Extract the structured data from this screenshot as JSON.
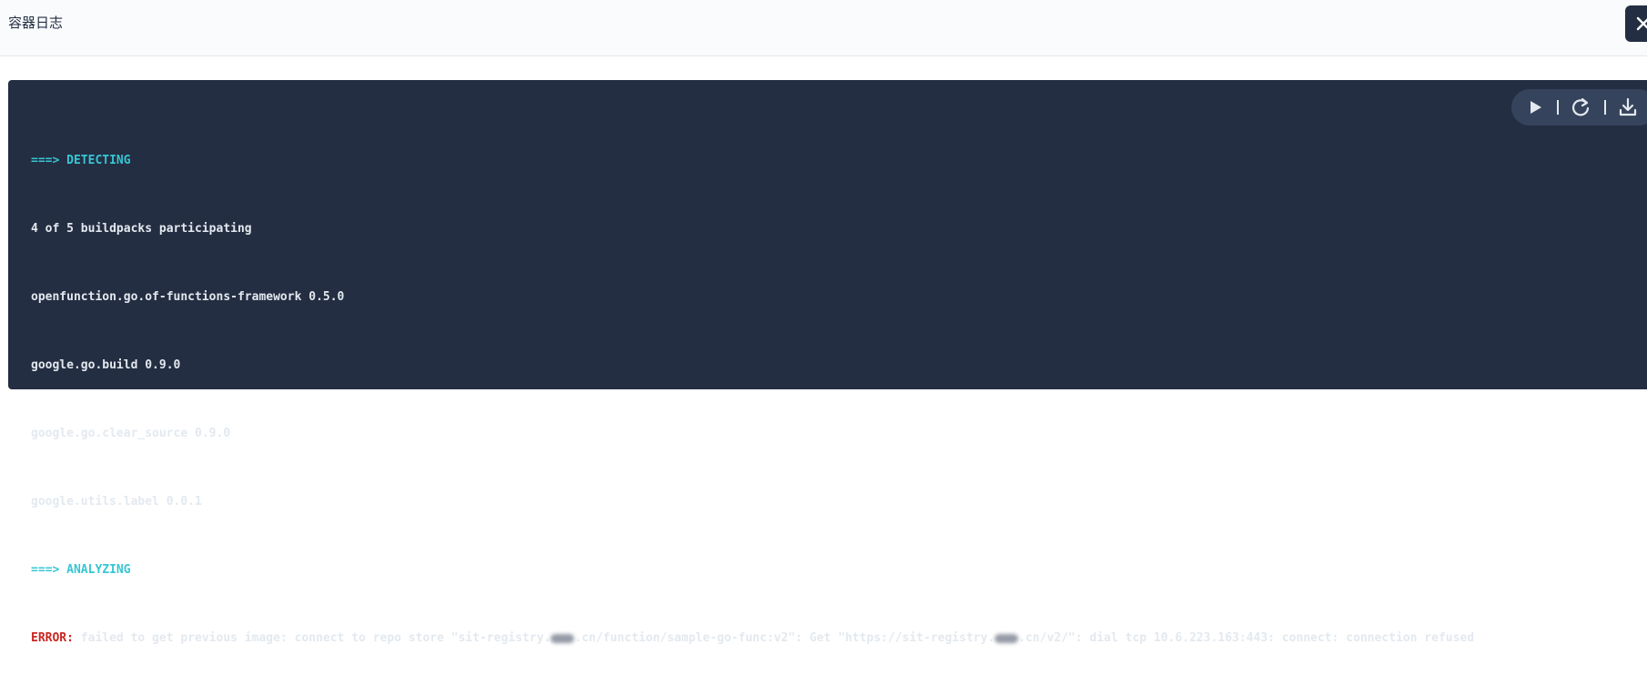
{
  "header": {
    "title": "容器日志",
    "close_icon": "close-icon"
  },
  "toolbar": {
    "icons": [
      "play-icon",
      "refresh-icon",
      "download-icon"
    ]
  },
  "log": {
    "lines": [
      {
        "prefix": "===> ",
        "text": "DETECTING",
        "style": "cyan"
      },
      {
        "text": "4 of 5 buildpacks participating"
      },
      {
        "text": "openfunction.go.of-functions-framework 0.5.0"
      },
      {
        "text": "google.go.build 0.9.0"
      },
      {
        "text": "google.go.clear_source 0.9.0"
      },
      {
        "text": "google.utils.label 0.0.1"
      },
      {
        "prefix": "===> ",
        "text": "ANALYZING",
        "style": "cyan"
      },
      {
        "error_label": "ERROR:",
        "part1": " failed to get previous image: connect to repo store \"sit-registry.",
        "part2": ".cn/function/sample-go-func:v2\": Get \"https://sit-registry.",
        "part3": ".cn/v2/\": dial tcp 10.6.223.163:443: connect: connection refused"
      }
    ]
  },
  "colors": {
    "terminal_bg": "#242e42",
    "cyan": "#36c6d3",
    "error_red": "#ca2621",
    "text": "#e3e9ef"
  }
}
